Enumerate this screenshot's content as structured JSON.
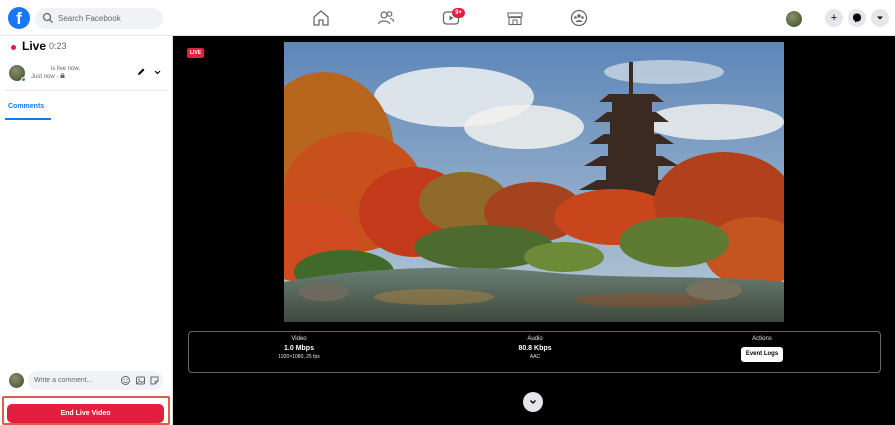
{
  "topbar": {
    "logo_letter": "f",
    "search_placeholder": "Search Facebook",
    "nav_icons": [
      "home-icon",
      "friends-icon",
      "watch-icon",
      "marketplace-icon",
      "groups-icon"
    ],
    "watch_badge": "9+",
    "right_buttons": [
      "plus-icon",
      "messenger-icon",
      "chevron-down-icon"
    ],
    "accent": "#1877f2"
  },
  "sidebar": {
    "live_label": "Live",
    "live_time": "0:23",
    "host_status": "is live now.",
    "host_time": "Just now · ",
    "comments_tab": "Comments",
    "comment_placeholder": "Write a comment...",
    "end_button": "End Live Video",
    "end_color": "#e41e3f"
  },
  "stage": {
    "live_chip": "LIVE",
    "stats": {
      "video_title": "Video",
      "video_bitrate": "1.0 Mbps",
      "video_resolution": "1920×1080, 25 fps",
      "audio_title": "Audio",
      "audio_bitrate": "80.8 Kbps",
      "audio_codec": "AAC",
      "actions_title": "Actions",
      "event_logs": "Event Logs"
    }
  }
}
